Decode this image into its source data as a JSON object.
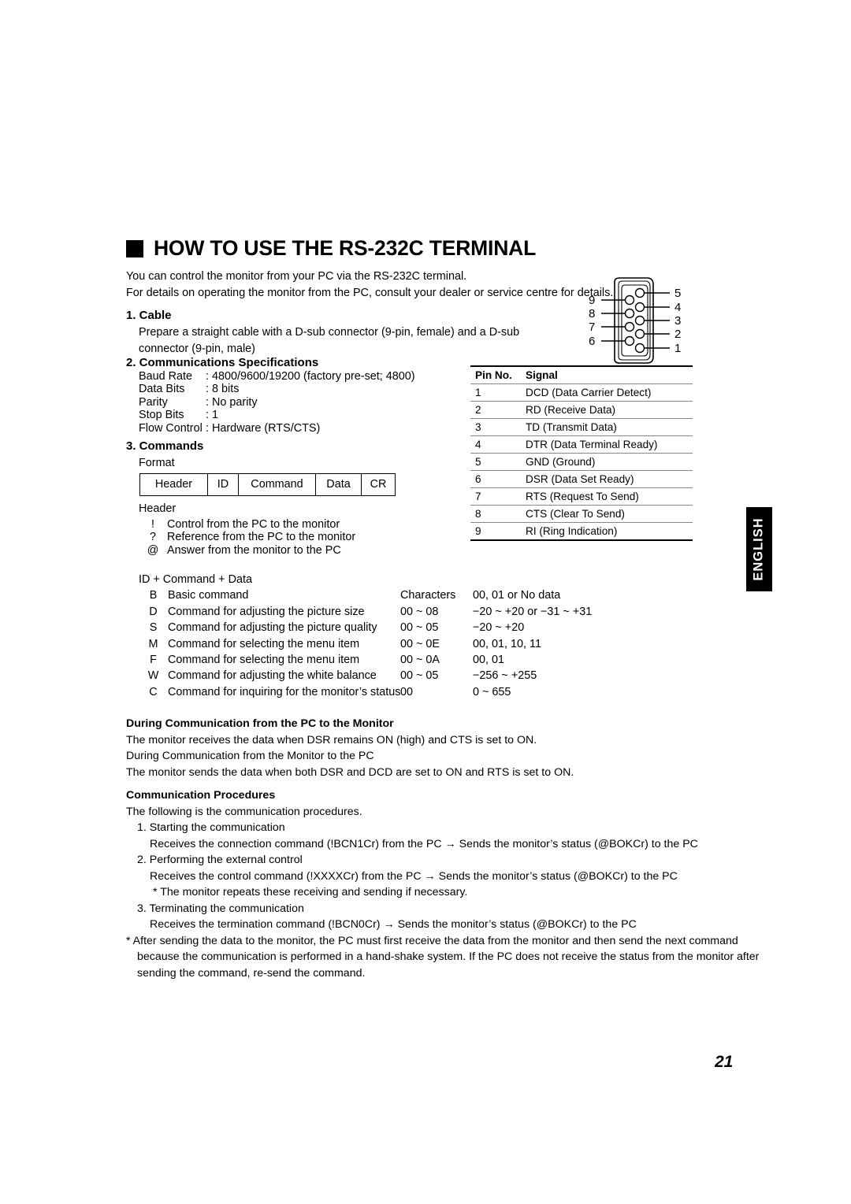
{
  "title": {
    "bullet": "filled-square-bullet",
    "text": "HOW TO USE THE RS-232C TERMINAL"
  },
  "intro": {
    "line1": "You can control the monitor from your PC via the RS-232C terminal.",
    "line2": "For details on operating the monitor from the PC, consult your dealer or service centre for details."
  },
  "cable": {
    "heading": "1. Cable",
    "line1": "Prepare a straight cable with a D-sub connector (9-pin, female) and a D-sub",
    "line2": "connector (9-pin, male)"
  },
  "connector_diagram": {
    "name": "d-sub-9pin-connector",
    "left_labels": [
      "9",
      "8",
      "7",
      "6"
    ],
    "right_labels": [
      "5",
      "4",
      "3",
      "2",
      "1"
    ]
  },
  "comm_specs": {
    "heading": "2. Communications Specifications",
    "rows": [
      {
        "key": "Baud Rate",
        "value": ": 4800/9600/19200 (factory pre-set; 4800)"
      },
      {
        "key": "Data Bits",
        "value": ": 8 bits"
      },
      {
        "key": "Parity",
        "value": ": No parity"
      },
      {
        "key": "Stop Bits",
        "value": ": 1"
      },
      {
        "key": "Flow Control",
        "value": ": Hardware (RTS/CTS)"
      }
    ]
  },
  "commands": {
    "heading": "3. Commands",
    "format_label": "Format",
    "format_cells": [
      "Header",
      "ID",
      "Command",
      "Data",
      "CR"
    ],
    "header_label": "Header",
    "header_rows": [
      {
        "sym": "!",
        "desc": "Control from the PC to the monitor"
      },
      {
        "sym": "?",
        "desc": "Reference from the PC to the monitor"
      },
      {
        "sym": "@",
        "desc": "Answer from the monitor to the PC"
      }
    ],
    "id_line": "ID + Command + Data",
    "cmd_rows": [
      {
        "sym": "B",
        "desc": "Basic command",
        "chars": "Characters",
        "range": "00, 01 or No data"
      },
      {
        "sym": "D",
        "desc": "Command for adjusting the picture size",
        "chars": "00 ~ 08",
        "range": "−20 ~ +20 or −31 ~ +31"
      },
      {
        "sym": "S",
        "desc": "Command for adjusting the picture quality",
        "chars": "00 ~ 05",
        "range": "−20 ~ +20"
      },
      {
        "sym": "M",
        "desc": "Command for selecting the menu item",
        "chars": "00 ~ 0E",
        "range": "00, 01, 10, 11"
      },
      {
        "sym": "F",
        "desc": "Command for selecting the menu item",
        "chars": "00 ~ 0A",
        "range": "00, 01"
      },
      {
        "sym": "W",
        "desc": "Command for adjusting the white balance",
        "chars": "00 ~ 05",
        "range": "−256 ~ +255"
      },
      {
        "sym": "C",
        "desc": "Command for inquiring for the monitor’s status",
        "chars": "00",
        "range": "0 ~ 655"
      }
    ]
  },
  "pin_table": {
    "columns": [
      "Pin No.",
      "Signal"
    ],
    "rows": [
      {
        "pin": "1",
        "signal": "DCD (Data Carrier Detect)"
      },
      {
        "pin": "2",
        "signal": "RD (Receive Data)"
      },
      {
        "pin": "3",
        "signal": "TD (Transmit Data)"
      },
      {
        "pin": "4",
        "signal": "DTR (Data Terminal Ready)"
      },
      {
        "pin": "5",
        "signal": "GND (Ground)"
      },
      {
        "pin": "6",
        "signal": "DSR (Data Set Ready)"
      },
      {
        "pin": "7",
        "signal": "RTS (Request To Send)"
      },
      {
        "pin": "8",
        "signal": "CTS (Clear To Send)"
      },
      {
        "pin": "9",
        "signal": "RI (Ring Indication)"
      }
    ]
  },
  "during_comm": {
    "heading": "During Communication from the PC to the Monitor",
    "line1": "The monitor receives the data when DSR remains ON (high) and CTS is set to ON.",
    "line2": "During Communication from the Monitor to the PC",
    "line3": "The monitor sends the data when both DSR and DCD are set to ON and RTS is set to ON."
  },
  "procedures": {
    "heading": "Communication Procedures",
    "intro": "The following is the communication procedures.",
    "step1_title": "1. Starting the communication",
    "step1_body": "Receives the connection command (!BCN1Cr) from the PC → Sends the monitor’s status (@BOKCr) to the PC",
    "step2_title": "2. Performing the external control",
    "step2_body": "Receives the control command (!XXXXCr) from the PC → Sends the monitor’s status (@BOKCr) to the PC",
    "step2_note": "* The monitor repeats these receiving and sending if necessary.",
    "step3_title": "3. Terminating the communication",
    "step3_body": "Receives the termination command (!BCN0Cr) → Sends the monitor’s status (@BOKCr) to the PC",
    "footnote_line1": "* After sending the data to the monitor, the PC must first receive the data from the monitor and then send the next command",
    "footnote_line2": "because the communication is performed in a hand-shake system. If the PC does not receive the status from the monitor after",
    "footnote_line3": "sending the command, re-send the command."
  },
  "language_tab": "ENGLISH",
  "page_number": "21"
}
